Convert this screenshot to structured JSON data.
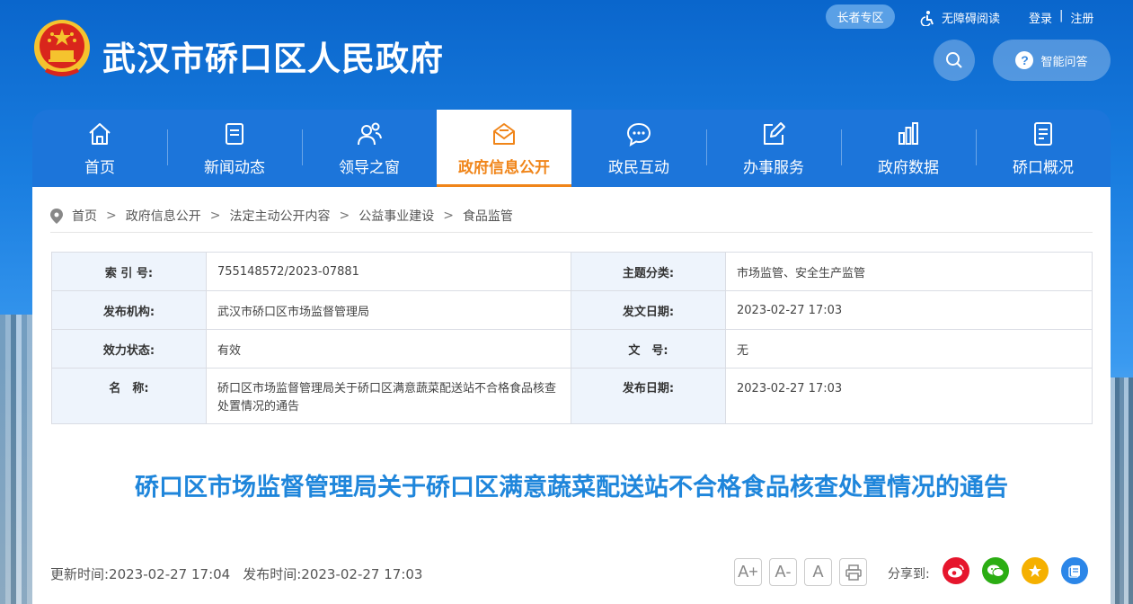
{
  "header": {
    "site_title": "武汉市硚口区人民政府",
    "elder_label": "长者专区",
    "a11y_label": "无障碍阅读",
    "login_label": "登录",
    "divider": "|",
    "register_label": "注册",
    "qa_label": "智能问答"
  },
  "nav": {
    "items": [
      {
        "label": "首页",
        "icon": "home-icon"
      },
      {
        "label": "新闻动态",
        "icon": "news-icon"
      },
      {
        "label": "领导之窗",
        "icon": "leaders-icon"
      },
      {
        "label": "政府信息公开",
        "icon": "mail-icon"
      },
      {
        "label": "政民互动",
        "icon": "chat-icon"
      },
      {
        "label": "办事服务",
        "icon": "edit-icon"
      },
      {
        "label": "政府数据",
        "icon": "bar-chart-icon"
      },
      {
        "label": "硚口概况",
        "icon": "document-icon"
      }
    ],
    "active_index": 3
  },
  "breadcrumb": [
    "首页",
    "政府信息公开",
    "法定主动公开内容",
    "公益事业建设",
    "食品监管"
  ],
  "meta": {
    "rows": [
      {
        "k1": "索 引 号:",
        "v1": "755148572/2023-07881",
        "k2": "主题分类:",
        "v2": "市场监管、安全生产监管"
      },
      {
        "k1": "发布机构:",
        "v1": "武汉市硚口区市场监督管理局",
        "k2": "发文日期:",
        "v2": "2023-02-27 17:03"
      },
      {
        "k1": "效力状态:",
        "v1": "有效",
        "k2": "文　号:",
        "v2": "无"
      },
      {
        "k1": "名　称:",
        "v1": "硚口区市场监督管理局关于硚口区满意蔬菜配送站不合格食品核查处置情况的通告",
        "k2": "发布日期:",
        "v2": "2023-02-27 17:03"
      }
    ]
  },
  "article": {
    "title": "硚口区市场监督管理局关于硚口区满意蔬菜配送站不合格食品核查处置情况的通告",
    "updated": "更新时间:2023-02-27 17:04",
    "published": "发布时间:2023-02-27 17:03"
  },
  "tools": {
    "font_large": "A+",
    "font_small": "A-",
    "font_reset": "A"
  },
  "share": {
    "label": "分享到:",
    "icons": [
      "weibo-icon",
      "wechat-icon",
      "qzone-icon",
      "copy-icon"
    ]
  },
  "colors": {
    "primary_blue": "#1c75da",
    "active_orange": "#f08519",
    "title_blue": "#1f86db"
  }
}
